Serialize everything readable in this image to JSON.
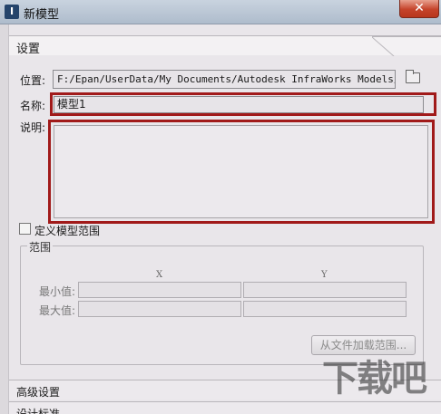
{
  "window": {
    "title": "新模型",
    "close_label": "✕"
  },
  "settings": {
    "section_label": "设置",
    "location_label": "位置:",
    "location_value": "F:/Epan/UserData/My Documents/Autodesk InfraWorks Models/模型",
    "name_label": "名称:",
    "name_value": "模型1",
    "description_label": "说明:",
    "description_value": "",
    "define_range_label": "定义模型范围",
    "define_range_checked": false,
    "range": {
      "group_label": "范围",
      "x_header": "X",
      "y_header": "Y",
      "min_label": "最小值:",
      "max_label": "最大值:",
      "min_x": "",
      "min_y": "",
      "max_x": "",
      "max_y": "",
      "load_button_label": "从文件加载范围..."
    }
  },
  "advanced_section_label": "高级设置",
  "design_standard_label": "设计标准",
  "watermark_text": "下载吧",
  "colors": {
    "highlight": "#a11a1a"
  },
  "icons": {
    "app": "app-icon",
    "folder": "folder-icon",
    "close": "close-icon"
  }
}
